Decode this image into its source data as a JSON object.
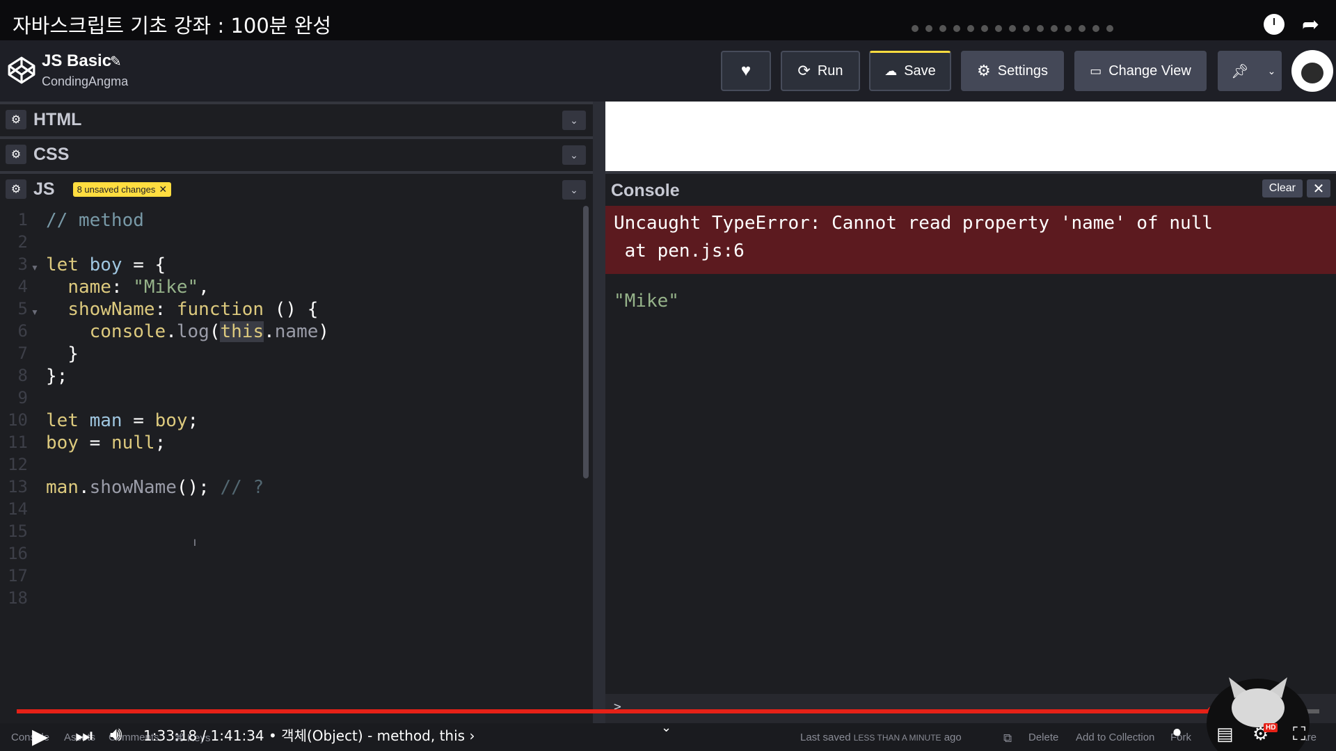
{
  "video": {
    "title": "자바스크립트 기초 강좌 : 100분 완성",
    "time": "1:33:18 / 1:41:34 • 객체(Object) - method, this ›",
    "progress": 0.918
  },
  "header": {
    "pen_title": "JS Basic",
    "author": "CondingAngma",
    "buttons": {
      "run": "Run",
      "save": "Save",
      "settings": "Settings",
      "change_view": "Change View"
    }
  },
  "panes": {
    "html": "HTML",
    "css": "CSS",
    "js": "JS",
    "unsaved": "8 unsaved changes"
  },
  "code": {
    "line_numbers": [
      "1",
      "2",
      "3",
      "4",
      "5",
      "6",
      "7",
      "8",
      "9",
      "10",
      "11",
      "12",
      "13",
      "14",
      "15",
      "16",
      "17",
      "18"
    ]
  },
  "console": {
    "title": "Console",
    "clear": "Clear",
    "error_line1": "Uncaught TypeError: Cannot read property 'name' of null",
    "error_line2": " at pen.js:6",
    "log": "\"Mike\"",
    "prompt": ">"
  },
  "footer": {
    "tabs": [
      "Console",
      "Assets",
      "Comments",
      "⌘ Keys"
    ],
    "last_saved_label": "Last saved",
    "last_saved_value": "LESS THAN A MINUTE",
    "last_saved_suffix": "ago",
    "delete": "Delete",
    "add_to_collection": "Add to Collection",
    "fork": "Fork",
    "share": "Share"
  },
  "colors": {
    "accent_yellow": "#ffdd40",
    "error_bg": "#5c1a1f",
    "progress_red": "#e62117"
  },
  "icons": [
    "heart-icon",
    "run-icon",
    "cloud-icon",
    "gear-icon",
    "change-view-icon",
    "pin-icon",
    "play-icon",
    "next-icon",
    "volume-icon",
    "subtitles-icon",
    "settings-icon",
    "fullscreen-icon"
  ]
}
